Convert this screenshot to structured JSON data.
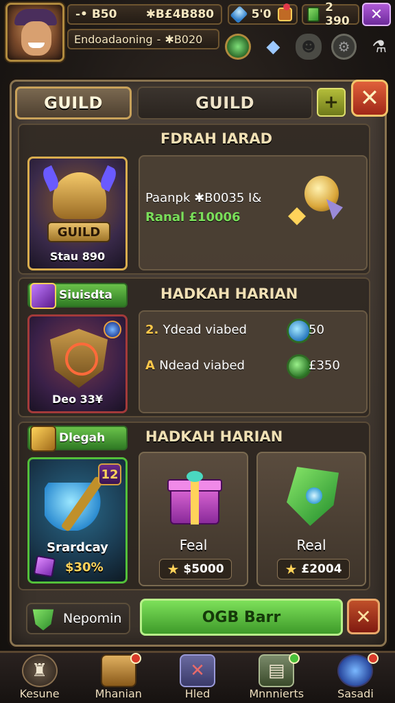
{
  "hud": {
    "gold_value": "-• B50",
    "gold_total": "✱B£4B880",
    "player_name": "Endoadaoning",
    "player_sep": "-",
    "player_points": "✱B020",
    "gems_value": "5'0",
    "green_gems": "2 390",
    "avatar_icon": "hero-portrait",
    "close_icon": "close-icon"
  },
  "tabs": {
    "active": "GUILD",
    "inactive": "GUILD"
  },
  "section1": {
    "title": "FDRAH IARAD",
    "card_badge": "GUILD",
    "card_caption": "Stau 890",
    "info_line1": "Paanpk ✱B0035 I&",
    "info_line2": "Ranal £10006"
  },
  "section2": {
    "chip_label": "Siuisdta",
    "title": "HADKAH HARIAN",
    "card_caption": "Deo 33¥",
    "rows": [
      {
        "prefix": "2.",
        "text": "Ydead viabed",
        "reward": "50"
      },
      {
        "prefix": "A",
        "text": "Ndead viabed",
        "reward": "£350"
      }
    ]
  },
  "section3": {
    "chip_label": "Dlegah",
    "title": "HADKAH HARIAN",
    "card_level": "12",
    "card_name": "Srardcay",
    "card_price": "$30%",
    "tiles": [
      {
        "name": "Feal",
        "price": "$5000"
      },
      {
        "name": "Real",
        "price": "£2004"
      }
    ]
  },
  "actions": {
    "left_label": "Nepomin",
    "main_label": "OGB Barr"
  },
  "nav": [
    {
      "label": "Kesune",
      "icon": "castle-icon"
    },
    {
      "label": "Mhanian",
      "icon": "chest-icon"
    },
    {
      "label": "Hled",
      "icon": "crossed-swords-icon"
    },
    {
      "label": "Mnnnierts",
      "icon": "scroll-icon"
    },
    {
      "label": "Sasadi",
      "icon": "orb-icon"
    }
  ]
}
